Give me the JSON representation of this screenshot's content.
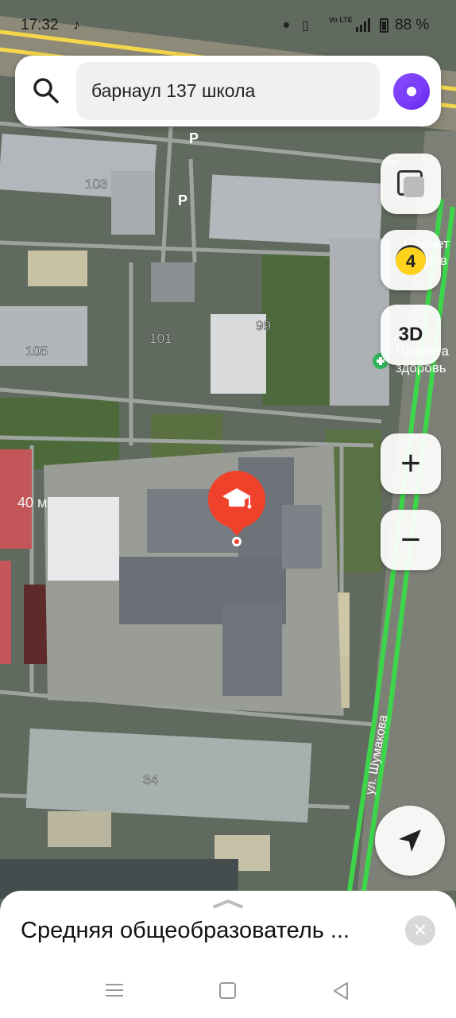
{
  "status_bar": {
    "time": "17:32",
    "battery_percent": "88 %",
    "network_volte": "Vo LTE",
    "network_lte": "LTE"
  },
  "search": {
    "query": "барнаул 137 школа"
  },
  "map": {
    "labels": {
      "b103": "103",
      "b105": "105",
      "b101": "101",
      "b99": "99",
      "b34": "34",
      "scale": "40 м",
      "street": "ул. Шумакова",
      "poi1_line1": "Планет",
      "poi1_line2": "ров",
      "poi2_line1": "Планета",
      "poi2_line2": "здоровь",
      "parking": "P"
    }
  },
  "controls": {
    "traffic_level": "4",
    "btn_3d": "3D",
    "zoom_in": "+",
    "zoom_out": "−"
  },
  "sheet": {
    "title": "Средняя общеобразователь ..."
  },
  "colors": {
    "pin": "#f0412b",
    "alice": "#7a3cf7",
    "road_green": "#3dd64b",
    "road_yellow": "#f4d64a"
  }
}
